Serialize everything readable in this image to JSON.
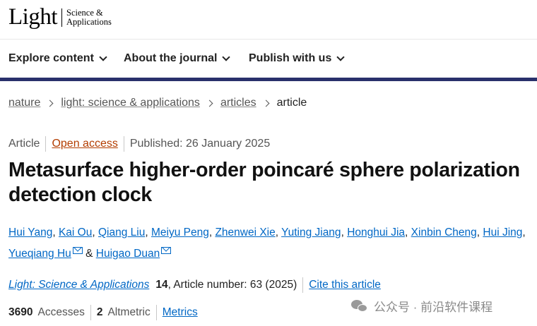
{
  "logo": {
    "main": "Light",
    "sub_line1": "Science &",
    "sub_line2": "Applications"
  },
  "nav": [
    {
      "label": "Explore content"
    },
    {
      "label": "About the journal"
    },
    {
      "label": "Publish with us"
    }
  ],
  "breadcrumb": {
    "items": [
      "nature",
      "light: science & applications",
      "articles"
    ],
    "current": "article"
  },
  "article": {
    "type": "Article",
    "access": "Open access",
    "published": "Published: 26 January 2025",
    "title": "Metasurface higher-order poincaré sphere polarization detection clock",
    "authors": [
      "Hui Yang",
      "Kai Ou",
      "Qiang Liu",
      "Meiyu Peng",
      "Zhenwei Xie",
      "Yuting Jiang",
      "Honghui Jia",
      "Xinbin Cheng",
      "Hui Jing",
      "Yueqiang Hu",
      "Huigao Duan"
    ],
    "separator": ",",
    "and": "&"
  },
  "citation": {
    "journal": "Light: Science & Applications",
    "volume": "14",
    "article_number": ", Article number: 63 (2025)",
    "cite_label": "Cite this article"
  },
  "metrics": {
    "accesses_count": "3690",
    "accesses_label": "Accesses",
    "altmetric_count": "2",
    "altmetric_label": "Altmetric",
    "link": "Metrics"
  },
  "watermark": {
    "text": "公众号 · 前沿软件课程"
  },
  "colors": {
    "nav_bar": "#29306b",
    "link": "#0067c5",
    "open_access": "#b33d00"
  }
}
